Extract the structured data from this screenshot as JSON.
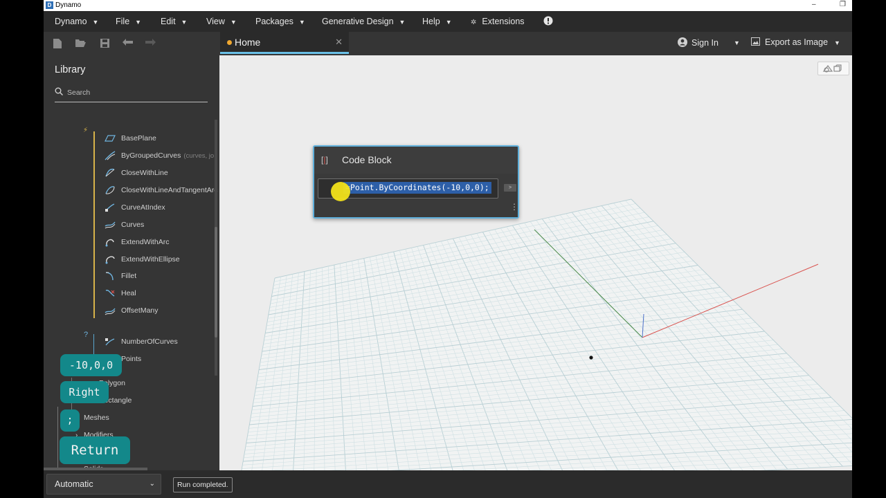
{
  "window": {
    "title": "Dynamo"
  },
  "menu": {
    "items": [
      "Dynamo",
      "File",
      "Edit",
      "View",
      "Packages",
      "Generative Design",
      "Help"
    ],
    "extensions_label": "Extensions"
  },
  "toolbar": {
    "icons": [
      "new-file-icon",
      "open-folder-icon",
      "save-icon",
      "undo-icon",
      "redo-icon"
    ]
  },
  "tab": {
    "label": "Home"
  },
  "top_right": {
    "sign_in": "Sign In",
    "export": "Export as Image"
  },
  "library": {
    "title": "Library",
    "search_placeholder": "Search",
    "items": [
      {
        "label": "BasePlane",
        "hint": ""
      },
      {
        "label": "ByGroupedCurves",
        "hint": "(curves, jo"
      },
      {
        "label": "CloseWithLine",
        "hint": ""
      },
      {
        "label": "CloseWithLineAndTangentArc",
        "hint": ""
      },
      {
        "label": "CurveAtIndex",
        "hint": ""
      },
      {
        "label": "Curves",
        "hint": ""
      },
      {
        "label": "ExtendWithArc",
        "hint": ""
      },
      {
        "label": "ExtendWithEllipse",
        "hint": ""
      },
      {
        "label": "Fillet",
        "hint": ""
      },
      {
        "label": "Heal",
        "hint": ""
      },
      {
        "label": "OffsetMany",
        "hint": ""
      }
    ],
    "query_items": [
      {
        "label": "NumberOfCurves"
      },
      {
        "label": "Points"
      }
    ],
    "categories": [
      "Polygon",
      "Rectangle",
      "Meshes",
      "Modifiers",
      "Solids"
    ],
    "section_marks": {
      "action": "⚡",
      "query": "?"
    }
  },
  "overlays": {
    "key1": "-10,0,0",
    "key2": "Right",
    "key3": ";",
    "key4": "Return"
  },
  "code_block": {
    "title": "Code Block",
    "code": "=Point.ByCoordinates(-10,0,0);",
    "port_label": ">"
  },
  "status": {
    "run_mode": "Automatic",
    "run_status": "Run completed."
  },
  "colors": {
    "accent": "#6ac0e7",
    "node_border": "#5fb0dc",
    "selection": "#2d5fa8",
    "overlay": "#13888a",
    "x_axis": "#d9534f",
    "y_axis": "#4a8a4a",
    "z_axis": "#4a6fc8"
  }
}
